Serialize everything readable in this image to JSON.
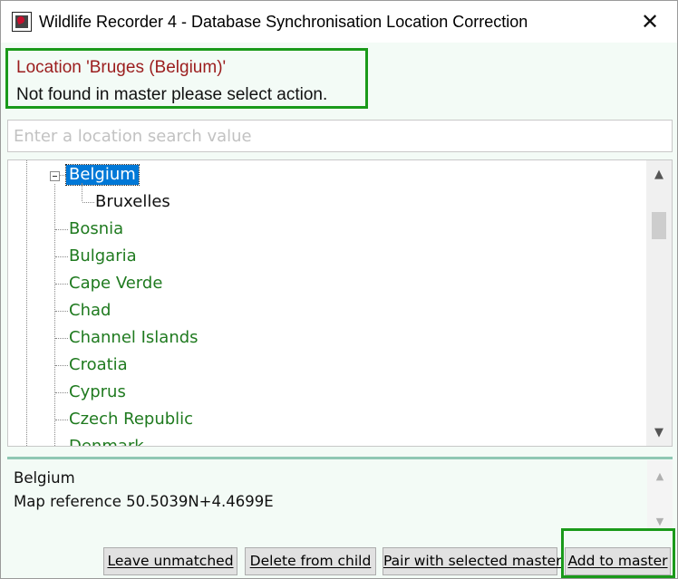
{
  "window": {
    "title": "Wildlife Recorder 4 - Database Synchronisation Location Correction",
    "close_glyph": "✕"
  },
  "message": {
    "line1": "Location 'Bruges (Belgium)'",
    "line2": "Not found in master please select action."
  },
  "search": {
    "placeholder": "Enter a location search value",
    "value": ""
  },
  "tree": {
    "selected_item": "Belgium",
    "items": [
      {
        "label": "Belgium",
        "level": 0,
        "expanded": true,
        "selected": true
      },
      {
        "label": "Bruxelles",
        "level": 1
      },
      {
        "label": "Bosnia",
        "level": 0
      },
      {
        "label": "Bulgaria",
        "level": 0
      },
      {
        "label": "Cape Verde",
        "level": 0
      },
      {
        "label": "Chad",
        "level": 0
      },
      {
        "label": "Channel Islands",
        "level": 0
      },
      {
        "label": "Croatia",
        "level": 0
      },
      {
        "label": "Cyprus",
        "level": 0
      },
      {
        "label": "Czech Republic",
        "level": 0
      },
      {
        "label": "Denmark",
        "level": 0
      }
    ],
    "scroll_up_glyph": "▲",
    "scroll_down_glyph": "▼"
  },
  "details": {
    "name": "Belgium",
    "map_reference": "Map reference 50.5039N+4.4699E"
  },
  "buttons": {
    "leave_unmatched": "Leave unmatched",
    "delete_from_child": "Delete from child",
    "pair_with_selected_master": "Pair with selected master",
    "add_to_master": "Add to master"
  },
  "colors": {
    "highlight_border": "#1a9a1a",
    "message_warning": "#9b1d1d",
    "tree_item_text": "#1f7a1f",
    "selection": "#0078d7",
    "background": "#f3fbf6"
  }
}
